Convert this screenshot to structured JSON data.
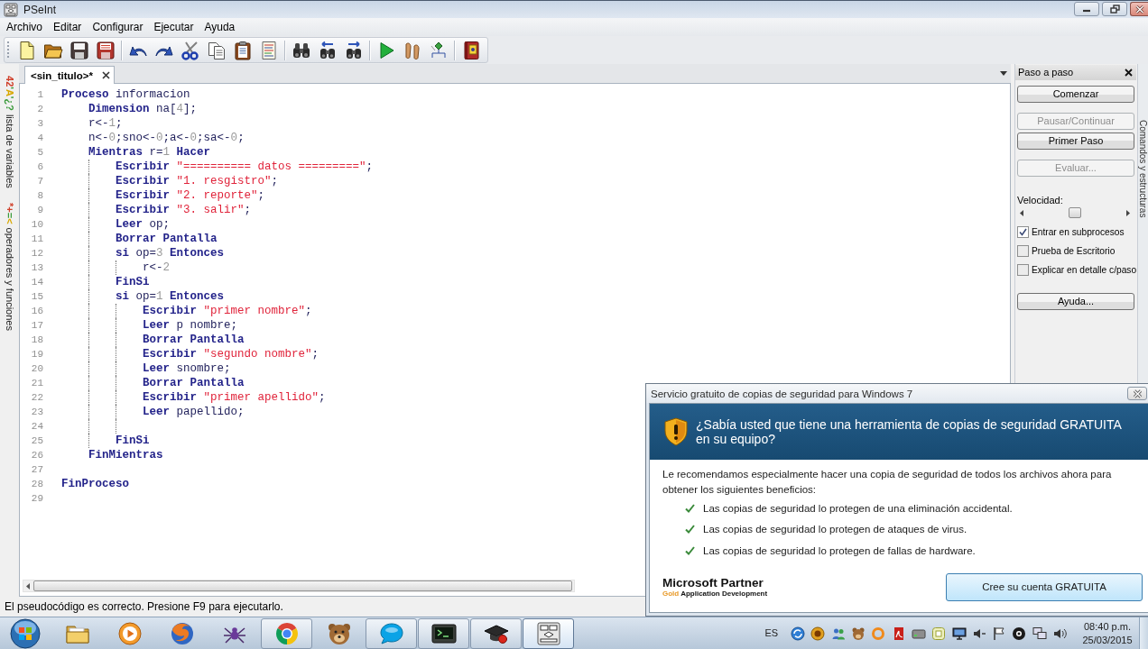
{
  "window": {
    "title": "PSeInt"
  },
  "menu": [
    "Archivo",
    "Editar",
    "Configurar",
    "Ejecutar",
    "Ayuda"
  ],
  "side_tabs": [
    {
      "symbols": "42'A'¿?",
      "label": "lista de variables"
    },
    {
      "symbols": "*+=<",
      "label": "operadores y funciones"
    }
  ],
  "editor": {
    "tabs": [
      {
        "label": "<sin_titulo>*",
        "selected": true
      }
    ],
    "lines": [
      {
        "number": "1",
        "tokens": [
          {
            "kind": "keyword",
            "text": "Proceso"
          },
          {
            "kind": "plain",
            "text": " informacion"
          }
        ],
        "children": [
          {
            "number": "2",
            "tokens": [
              {
                "kind": "keyword",
                "text": "Dimension"
              },
              {
                "kind": "plain",
                "text": " na["
              },
              {
                "kind": "number",
                "text": "4"
              },
              {
                "kind": "plain",
                "text": "];"
              }
            ]
          },
          {
            "number": "3",
            "tokens": [
              {
                "kind": "plain",
                "text": "r<-"
              },
              {
                "kind": "number",
                "text": "1"
              },
              {
                "kind": "plain",
                "text": ";"
              }
            ]
          },
          {
            "number": "4",
            "tokens": [
              {
                "kind": "plain",
                "text": "n<-"
              },
              {
                "kind": "number",
                "text": "0"
              },
              {
                "kind": "plain",
                "text": ";sno<-"
              },
              {
                "kind": "number",
                "text": "0"
              },
              {
                "kind": "plain",
                "text": ";a<-"
              },
              {
                "kind": "number",
                "text": "0"
              },
              {
                "kind": "plain",
                "text": ";sa<-"
              },
              {
                "kind": "number",
                "text": "0"
              },
              {
                "kind": "plain",
                "text": ";"
              }
            ]
          },
          {
            "number": "5",
            "tokens": [
              {
                "kind": "keyword",
                "text": "Mientras"
              },
              {
                "kind": "plain",
                "text": " r="
              },
              {
                "kind": "number",
                "text": "1"
              },
              {
                "kind": "keyword",
                "text": " Hacer"
              }
            ],
            "children": [
              {
                "number": "6",
                "tokens": [
                  {
                    "kind": "keyword",
                    "text": "Escribir"
                  },
                  {
                    "kind": "string",
                    "text": " \"========== datos =========\""
                  },
                  {
                    "kind": "plain",
                    "text": ";"
                  }
                ]
              },
              {
                "number": "7",
                "tokens": [
                  {
                    "kind": "keyword",
                    "text": "Escribir"
                  },
                  {
                    "kind": "string",
                    "text": " \"1. resgistro\""
                  },
                  {
                    "kind": "plain",
                    "text": ";"
                  }
                ]
              },
              {
                "number": "8",
                "tokens": [
                  {
                    "kind": "keyword",
                    "text": "Escribir"
                  },
                  {
                    "kind": "string",
                    "text": " \"2. reporte\""
                  },
                  {
                    "kind": "plain",
                    "text": ";"
                  }
                ]
              },
              {
                "number": "9",
                "tokens": [
                  {
                    "kind": "keyword",
                    "text": "Escribir"
                  },
                  {
                    "kind": "string",
                    "text": " \"3. salir\""
                  },
                  {
                    "kind": "plain",
                    "text": ";"
                  }
                ]
              },
              {
                "number": "10",
                "tokens": [
                  {
                    "kind": "keyword",
                    "text": "Leer"
                  },
                  {
                    "kind": "plain",
                    "text": " op;"
                  }
                ]
              },
              {
                "number": "11",
                "tokens": [
                  {
                    "kind": "keyword",
                    "text": "Borrar Pantalla"
                  }
                ]
              },
              {
                "number": "12",
                "tokens": [
                  {
                    "kind": "keyword",
                    "text": "si"
                  },
                  {
                    "kind": "plain",
                    "text": " op="
                  },
                  {
                    "kind": "number",
                    "text": "3"
                  },
                  {
                    "kind": "keyword",
                    "text": " Entonces"
                  }
                ],
                "children": [
                  {
                    "number": "13",
                    "tokens": [
                      {
                        "kind": "plain",
                        "text": "r<-"
                      },
                      {
                        "kind": "number",
                        "text": "2"
                      }
                    ]
                  }
                ]
              },
              {
                "number": "14",
                "tokens": [
                  {
                    "kind": "keyword",
                    "text": "FinSi"
                  }
                ]
              },
              {
                "number": "15",
                "tokens": [
                  {
                    "kind": "keyword",
                    "text": "si"
                  },
                  {
                    "kind": "plain",
                    "text": " op="
                  },
                  {
                    "kind": "number",
                    "text": "1"
                  },
                  {
                    "kind": "keyword",
                    "text": " Entonces"
                  }
                ],
                "children": [
                  {
                    "number": "16",
                    "tokens": [
                      {
                        "kind": "keyword",
                        "text": "Escribir"
                      },
                      {
                        "kind": "string",
                        "text": " \"primer nombre\""
                      },
                      {
                        "kind": "plain",
                        "text": ";"
                      }
                    ]
                  },
                  {
                    "number": "17",
                    "tokens": [
                      {
                        "kind": "keyword",
                        "text": "Leer"
                      },
                      {
                        "kind": "plain",
                        "text": " p nombre;"
                      }
                    ]
                  },
                  {
                    "number": "18",
                    "tokens": [
                      {
                        "kind": "keyword",
                        "text": "Borrar Pantalla"
                      }
                    ]
                  },
                  {
                    "number": "19",
                    "tokens": [
                      {
                        "kind": "keyword",
                        "text": "Escribir"
                      },
                      {
                        "kind": "string",
                        "text": " \"segundo nombre\""
                      },
                      {
                        "kind": "plain",
                        "text": ";"
                      }
                    ]
                  },
                  {
                    "number": "20",
                    "tokens": [
                      {
                        "kind": "keyword",
                        "text": "Leer"
                      },
                      {
                        "kind": "plain",
                        "text": " snombre;"
                      }
                    ]
                  },
                  {
                    "number": "21",
                    "tokens": [
                      {
                        "kind": "keyword",
                        "text": "Borrar Pantalla"
                      }
                    ]
                  },
                  {
                    "number": "22",
                    "tokens": [
                      {
                        "kind": "keyword",
                        "text": "Escribir"
                      },
                      {
                        "kind": "string",
                        "text": " \"primer apellido\""
                      },
                      {
                        "kind": "plain",
                        "text": ";"
                      }
                    ]
                  },
                  {
                    "number": "23",
                    "tokens": [
                      {
                        "kind": "keyword",
                        "text": "Leer"
                      },
                      {
                        "kind": "plain",
                        "text": " papellido;"
                      }
                    ]
                  },
                  {
                    "number": "24"
                  }
                ]
              },
              {
                "number": "25",
                "tokens": [
                  {
                    "kind": "keyword",
                    "text": "FinSi"
                  }
                ]
              }
            ]
          },
          {
            "number": "26",
            "tokens": [
              {
                "kind": "keyword",
                "text": "FinMientras"
              }
            ]
          },
          {
            "number": "27"
          }
        ]
      },
      {
        "number": "28",
        "tokens": [
          {
            "kind": "keyword",
            "text": "FinProceso"
          }
        ]
      },
      {
        "number": "29"
      }
    ]
  },
  "status_bar": {
    "message": "El pseudocódigo es correcto. Presione F9 para ejecutarlo."
  },
  "step_panel": {
    "title": "Paso a paso",
    "buttons": [
      {
        "label": "Comenzar",
        "disabled": false
      },
      {
        "label": "Pausar/Continuar",
        "disabled": true
      },
      {
        "label": "Primer Paso",
        "disabled": false
      },
      {
        "label": "Evaluar...",
        "disabled": true
      }
    ],
    "speed": {
      "label": "Velocidad:",
      "level": 0.5
    },
    "options": [
      {
        "label": "Entrar en subprocesos",
        "checked": true
      },
      {
        "label": "Prueba de Escritorio",
        "checked": false
      },
      {
        "label": "Explicar en detalle c/paso",
        "checked": false
      }
    ],
    "help_button": "Ayuda..."
  },
  "right_side_tab": {
    "label": "Comandos y estructuras"
  },
  "popup": {
    "title": "Servicio gratuito de copias de seguridad para Windows 7",
    "heading": "¿Sabía usted que tiene una herramienta de copias de seguridad GRATUITA en su equipo?",
    "intro": "Le recomendamos especialmente hacer una copia de seguridad de todos los archivos ahora para obtener los siguientes beneficios:",
    "benefits": [
      "Las copias de seguridad lo protegen de una eliminación accidental.",
      "Las copias de seguridad lo protegen de ataques de virus.",
      "Las copias de seguridad lo protegen de fallas de hardware."
    ],
    "partner": {
      "name": "Microsoft Partner",
      "tier": "Gold",
      "specialty": "Application Development"
    },
    "button": "Cree su cuenta GRATUITA"
  },
  "taskbar": {
    "buttons": [
      {
        "running": false,
        "selected": false
      },
      {
        "running": false,
        "selected": false
      },
      {
        "running": false,
        "selected": false
      },
      {
        "running": false,
        "selected": false
      },
      {
        "running": true,
        "selected": false
      },
      {
        "running": false,
        "selected": false
      },
      {
        "running": true,
        "selected": false
      },
      {
        "running": true,
        "selected": false
      },
      {
        "running": true,
        "selected": false
      },
      {
        "running": true,
        "selected": true
      }
    ],
    "language": "ES",
    "time": "08:40 p.m.",
    "date": "25/03/2015"
  }
}
